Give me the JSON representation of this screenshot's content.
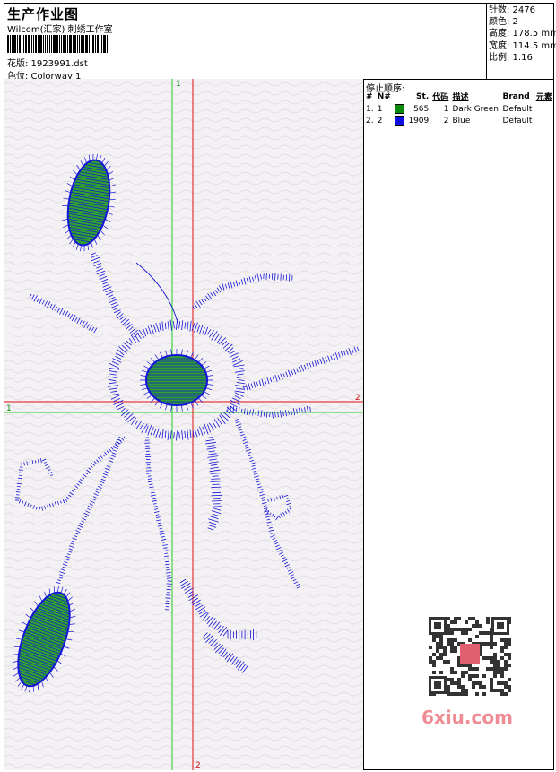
{
  "header": {
    "title": "生产作业图",
    "studio": "Wilcom(汇家) 刺绣工作室",
    "file_line": "花版:  1923991.dst",
    "colorway_line": "色位:  Colorway 1"
  },
  "stats": {
    "stitches": "针数: 2476",
    "colors": "颜色: 2",
    "height": "高度: 178.5 mm",
    "width": "宽度: 114.5 mm",
    "scale": "比例: 1.16"
  },
  "stop_sequence": {
    "heading": "停止顺序:",
    "columns": [
      "#",
      "N#",
      "St.",
      "代码",
      "描述",
      "Brand",
      "元素"
    ],
    "rows": [
      {
        "index": "1.",
        "needle": "1",
        "color": "#0a8a0a",
        "stitches": "565",
        "code": "1",
        "description": "Dark Green",
        "brand": "Default"
      },
      {
        "index": "2.",
        "needle": "2",
        "color": "#1010e0",
        "stitches": "1909",
        "code": "2",
        "description": "Blue",
        "brand": "Default"
      }
    ]
  },
  "canvas": {
    "axis_green_label_top": "1",
    "axis_green_label_left": "1",
    "axis_red_label_right": "2",
    "axis_red_label_bottom": "2",
    "thread_colors": {
      "green": "#2fa02f",
      "blue": "#1515d8"
    }
  },
  "watermark": {
    "text": "6xiu.com",
    "seal": "汉服网"
  }
}
